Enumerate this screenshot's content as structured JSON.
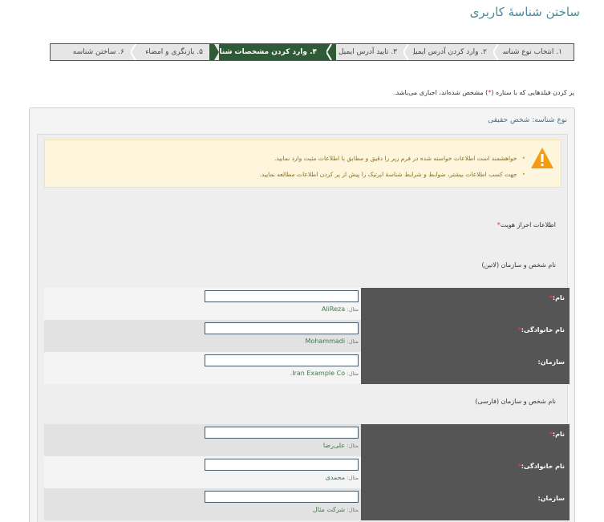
{
  "page": {
    "title": "ساختن شناسهٔ کاربری"
  },
  "wizard": {
    "steps": [
      {
        "label": "۱. انتخاب نوع شناسه"
      },
      {
        "label": "۲. وارد کردن آدرس ایمیل"
      },
      {
        "label": "۳. تایید آدرس ایمیل"
      },
      {
        "label": "۴. وارد کردن مشخصات شناسه"
      },
      {
        "label": "۵. بازنگری و امضاء"
      },
      {
        "label": "۶. ساختن شناسه"
      }
    ],
    "active_index": 3,
    "active_color": "#2e5b36"
  },
  "notice": {
    "required_text_before": "پر کردن فیلدهایی که با ستاره (",
    "star": "*",
    "required_text_after": ") مشخص شده‌اند، اجباری می‌باشد."
  },
  "panel": {
    "header": "نوع شناسه: شخص حقیقی",
    "warning": {
      "icon": "warning-triangle-icon",
      "items": [
        "خواهشمند است اطلاعات خواسته شده در فرم زیر را دقیق و مطابق با اطلاعات مثبت وارد نمایید.",
        "جهت کسب اطلاعات بیشتر، ضوابط و شرایط شناسهٔ ایرتیک را پیش از پر کردن اطلاعات مطالعه نمایید."
      ]
    },
    "identity_label": "اطلاعات احراز هویت",
    "star": "*",
    "latin_section": {
      "title": "نام شخص و سازمان (لاتین)",
      "fields": [
        {
          "label": "نام:",
          "required": "*",
          "value": "",
          "example_prefix": "مثال:",
          "example": "AliReza"
        },
        {
          "label": "نام خانوادگی:",
          "required": "*",
          "value": "",
          "example_prefix": "مثال:",
          "example": "Mohammadi"
        },
        {
          "label": "سازمان:",
          "required": "",
          "value": "",
          "example_prefix": "مثال:",
          "example": "Iran Example Co."
        }
      ]
    },
    "persian_section": {
      "title": "نام شخص و سازمان (فارسی)",
      "fields": [
        {
          "label": "نام:",
          "required": "*",
          "value": "",
          "example_prefix": "مثال:",
          "example": "علی‌رضا"
        },
        {
          "label": "نام خانوادگی:",
          "required": "*",
          "value": "",
          "example_prefix": "مثال:",
          "example": "محمدی"
        },
        {
          "label": "سازمان:",
          "required": "",
          "value": "",
          "example_prefix": "مثال:",
          "example": "شرکت مثال"
        }
      ]
    }
  }
}
